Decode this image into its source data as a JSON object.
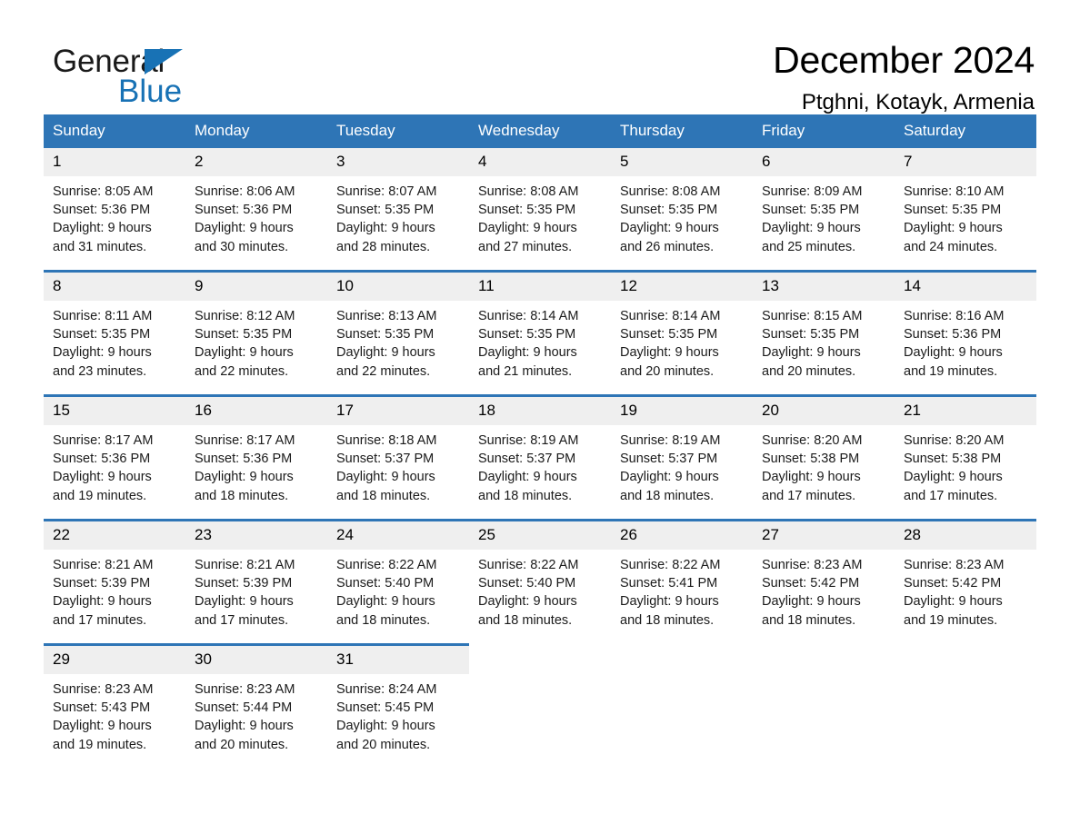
{
  "brand": {
    "name_part1": "General",
    "name_part2": "Blue",
    "triangle_icon": "triangle-icon",
    "accent_color": "#1872b5"
  },
  "header": {
    "title": "December 2024",
    "subtitle": "Ptghni, Kotayk, Armenia"
  },
  "colors": {
    "header_blue": "#2e75b6",
    "daynum_gray": "#efefef",
    "text": "#000000"
  },
  "weekdays": [
    "Sunday",
    "Monday",
    "Tuesday",
    "Wednesday",
    "Thursday",
    "Friday",
    "Saturday"
  ],
  "weeks": [
    [
      {
        "day": "1",
        "sunrise": "Sunrise: 8:05 AM",
        "sunset": "Sunset: 5:36 PM",
        "daylight_line1": "Daylight: 9 hours",
        "daylight_line2": "and 31 minutes."
      },
      {
        "day": "2",
        "sunrise": "Sunrise: 8:06 AM",
        "sunset": "Sunset: 5:36 PM",
        "daylight_line1": "Daylight: 9 hours",
        "daylight_line2": "and 30 minutes."
      },
      {
        "day": "3",
        "sunrise": "Sunrise: 8:07 AM",
        "sunset": "Sunset: 5:35 PM",
        "daylight_line1": "Daylight: 9 hours",
        "daylight_line2": "and 28 minutes."
      },
      {
        "day": "4",
        "sunrise": "Sunrise: 8:08 AM",
        "sunset": "Sunset: 5:35 PM",
        "daylight_line1": "Daylight: 9 hours",
        "daylight_line2": "and 27 minutes."
      },
      {
        "day": "5",
        "sunrise": "Sunrise: 8:08 AM",
        "sunset": "Sunset: 5:35 PM",
        "daylight_line1": "Daylight: 9 hours",
        "daylight_line2": "and 26 minutes."
      },
      {
        "day": "6",
        "sunrise": "Sunrise: 8:09 AM",
        "sunset": "Sunset: 5:35 PM",
        "daylight_line1": "Daylight: 9 hours",
        "daylight_line2": "and 25 minutes."
      },
      {
        "day": "7",
        "sunrise": "Sunrise: 8:10 AM",
        "sunset": "Sunset: 5:35 PM",
        "daylight_line1": "Daylight: 9 hours",
        "daylight_line2": "and 24 minutes."
      }
    ],
    [
      {
        "day": "8",
        "sunrise": "Sunrise: 8:11 AM",
        "sunset": "Sunset: 5:35 PM",
        "daylight_line1": "Daylight: 9 hours",
        "daylight_line2": "and 23 minutes."
      },
      {
        "day": "9",
        "sunrise": "Sunrise: 8:12 AM",
        "sunset": "Sunset: 5:35 PM",
        "daylight_line1": "Daylight: 9 hours",
        "daylight_line2": "and 22 minutes."
      },
      {
        "day": "10",
        "sunrise": "Sunrise: 8:13 AM",
        "sunset": "Sunset: 5:35 PM",
        "daylight_line1": "Daylight: 9 hours",
        "daylight_line2": "and 22 minutes."
      },
      {
        "day": "11",
        "sunrise": "Sunrise: 8:14 AM",
        "sunset": "Sunset: 5:35 PM",
        "daylight_line1": "Daylight: 9 hours",
        "daylight_line2": "and 21 minutes."
      },
      {
        "day": "12",
        "sunrise": "Sunrise: 8:14 AM",
        "sunset": "Sunset: 5:35 PM",
        "daylight_line1": "Daylight: 9 hours",
        "daylight_line2": "and 20 minutes."
      },
      {
        "day": "13",
        "sunrise": "Sunrise: 8:15 AM",
        "sunset": "Sunset: 5:35 PM",
        "daylight_line1": "Daylight: 9 hours",
        "daylight_line2": "and 20 minutes."
      },
      {
        "day": "14",
        "sunrise": "Sunrise: 8:16 AM",
        "sunset": "Sunset: 5:36 PM",
        "daylight_line1": "Daylight: 9 hours",
        "daylight_line2": "and 19 minutes."
      }
    ],
    [
      {
        "day": "15",
        "sunrise": "Sunrise: 8:17 AM",
        "sunset": "Sunset: 5:36 PM",
        "daylight_line1": "Daylight: 9 hours",
        "daylight_line2": "and 19 minutes."
      },
      {
        "day": "16",
        "sunrise": "Sunrise: 8:17 AM",
        "sunset": "Sunset: 5:36 PM",
        "daylight_line1": "Daylight: 9 hours",
        "daylight_line2": "and 18 minutes."
      },
      {
        "day": "17",
        "sunrise": "Sunrise: 8:18 AM",
        "sunset": "Sunset: 5:37 PM",
        "daylight_line1": "Daylight: 9 hours",
        "daylight_line2": "and 18 minutes."
      },
      {
        "day": "18",
        "sunrise": "Sunrise: 8:19 AM",
        "sunset": "Sunset: 5:37 PM",
        "daylight_line1": "Daylight: 9 hours",
        "daylight_line2": "and 18 minutes."
      },
      {
        "day": "19",
        "sunrise": "Sunrise: 8:19 AM",
        "sunset": "Sunset: 5:37 PM",
        "daylight_line1": "Daylight: 9 hours",
        "daylight_line2": "and 18 minutes."
      },
      {
        "day": "20",
        "sunrise": "Sunrise: 8:20 AM",
        "sunset": "Sunset: 5:38 PM",
        "daylight_line1": "Daylight: 9 hours",
        "daylight_line2": "and 17 minutes."
      },
      {
        "day": "21",
        "sunrise": "Sunrise: 8:20 AM",
        "sunset": "Sunset: 5:38 PM",
        "daylight_line1": "Daylight: 9 hours",
        "daylight_line2": "and 17 minutes."
      }
    ],
    [
      {
        "day": "22",
        "sunrise": "Sunrise: 8:21 AM",
        "sunset": "Sunset: 5:39 PM",
        "daylight_line1": "Daylight: 9 hours",
        "daylight_line2": "and 17 minutes."
      },
      {
        "day": "23",
        "sunrise": "Sunrise: 8:21 AM",
        "sunset": "Sunset: 5:39 PM",
        "daylight_line1": "Daylight: 9 hours",
        "daylight_line2": "and 17 minutes."
      },
      {
        "day": "24",
        "sunrise": "Sunrise: 8:22 AM",
        "sunset": "Sunset: 5:40 PM",
        "daylight_line1": "Daylight: 9 hours",
        "daylight_line2": "and 18 minutes."
      },
      {
        "day": "25",
        "sunrise": "Sunrise: 8:22 AM",
        "sunset": "Sunset: 5:40 PM",
        "daylight_line1": "Daylight: 9 hours",
        "daylight_line2": "and 18 minutes."
      },
      {
        "day": "26",
        "sunrise": "Sunrise: 8:22 AM",
        "sunset": "Sunset: 5:41 PM",
        "daylight_line1": "Daylight: 9 hours",
        "daylight_line2": "and 18 minutes."
      },
      {
        "day": "27",
        "sunrise": "Sunrise: 8:23 AM",
        "sunset": "Sunset: 5:42 PM",
        "daylight_line1": "Daylight: 9 hours",
        "daylight_line2": "and 18 minutes."
      },
      {
        "day": "28",
        "sunrise": "Sunrise: 8:23 AM",
        "sunset": "Sunset: 5:42 PM",
        "daylight_line1": "Daylight: 9 hours",
        "daylight_line2": "and 19 minutes."
      }
    ],
    [
      {
        "day": "29",
        "sunrise": "Sunrise: 8:23 AM",
        "sunset": "Sunset: 5:43 PM",
        "daylight_line1": "Daylight: 9 hours",
        "daylight_line2": "and 19 minutes."
      },
      {
        "day": "30",
        "sunrise": "Sunrise: 8:23 AM",
        "sunset": "Sunset: 5:44 PM",
        "daylight_line1": "Daylight: 9 hours",
        "daylight_line2": "and 20 minutes."
      },
      {
        "day": "31",
        "sunrise": "Sunrise: 8:24 AM",
        "sunset": "Sunset: 5:45 PM",
        "daylight_line1": "Daylight: 9 hours",
        "daylight_line2": "and 20 minutes."
      },
      null,
      null,
      null,
      null
    ]
  ]
}
